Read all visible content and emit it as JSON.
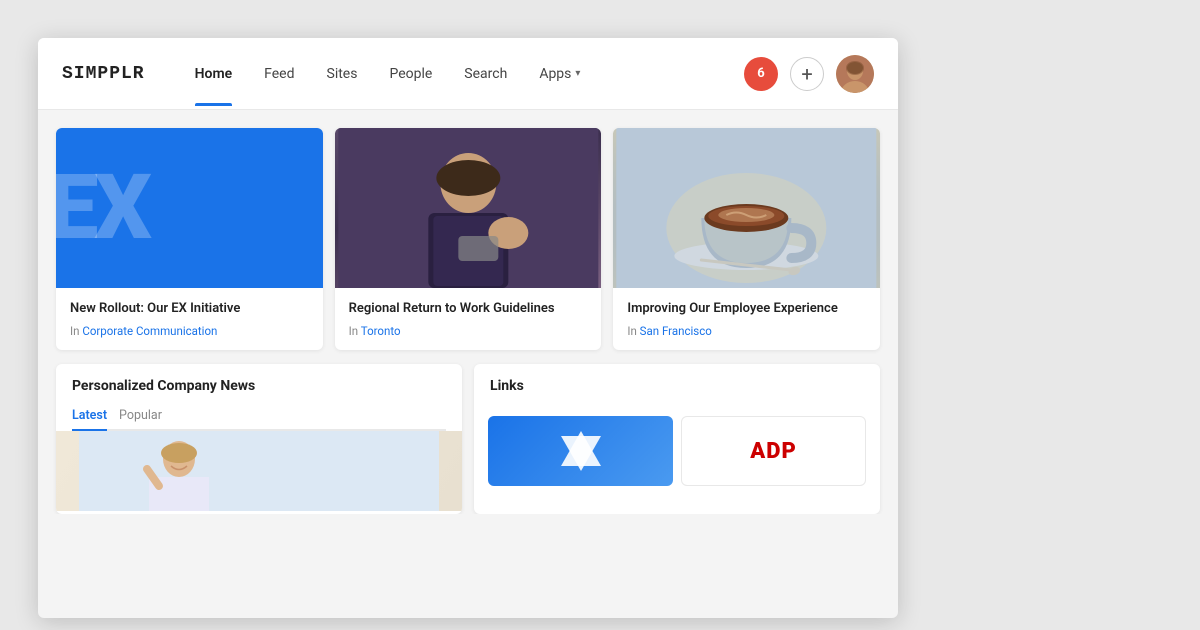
{
  "logo": {
    "text": "SIMPPLR"
  },
  "nav": {
    "links": [
      {
        "id": "home",
        "label": "Home",
        "active": true
      },
      {
        "id": "feed",
        "label": "Feed",
        "active": false
      },
      {
        "id": "sites",
        "label": "Sites",
        "active": false
      },
      {
        "id": "people",
        "label": "People",
        "active": false
      },
      {
        "id": "search",
        "label": "Search",
        "active": false
      },
      {
        "id": "apps",
        "label": "Apps",
        "active": false,
        "hasChevron": true
      }
    ],
    "notification_count": "6",
    "add_label": "+"
  },
  "cards": [
    {
      "id": "ex-initiative",
      "type": "ex",
      "title": "New Rollout: Our EX Initiative",
      "meta_prefix": "In",
      "category": "Corporate Communication",
      "category_href": "#"
    },
    {
      "id": "regional-return",
      "type": "woman",
      "title": "Regional Return to Work Guidelines",
      "meta_prefix": "In",
      "category": "Toronto",
      "category_href": "#"
    },
    {
      "id": "employee-experience",
      "type": "coffee",
      "title": "Improving Our Employee Experience",
      "meta_prefix": "In",
      "category": "San Francisco",
      "category_href": "#"
    }
  ],
  "personalized_news": {
    "title": "Personalized Company News",
    "tabs": [
      {
        "id": "latest",
        "label": "Latest",
        "active": true
      },
      {
        "id": "popular",
        "label": "Popular",
        "active": false
      }
    ]
  },
  "links": {
    "title": "Links"
  }
}
